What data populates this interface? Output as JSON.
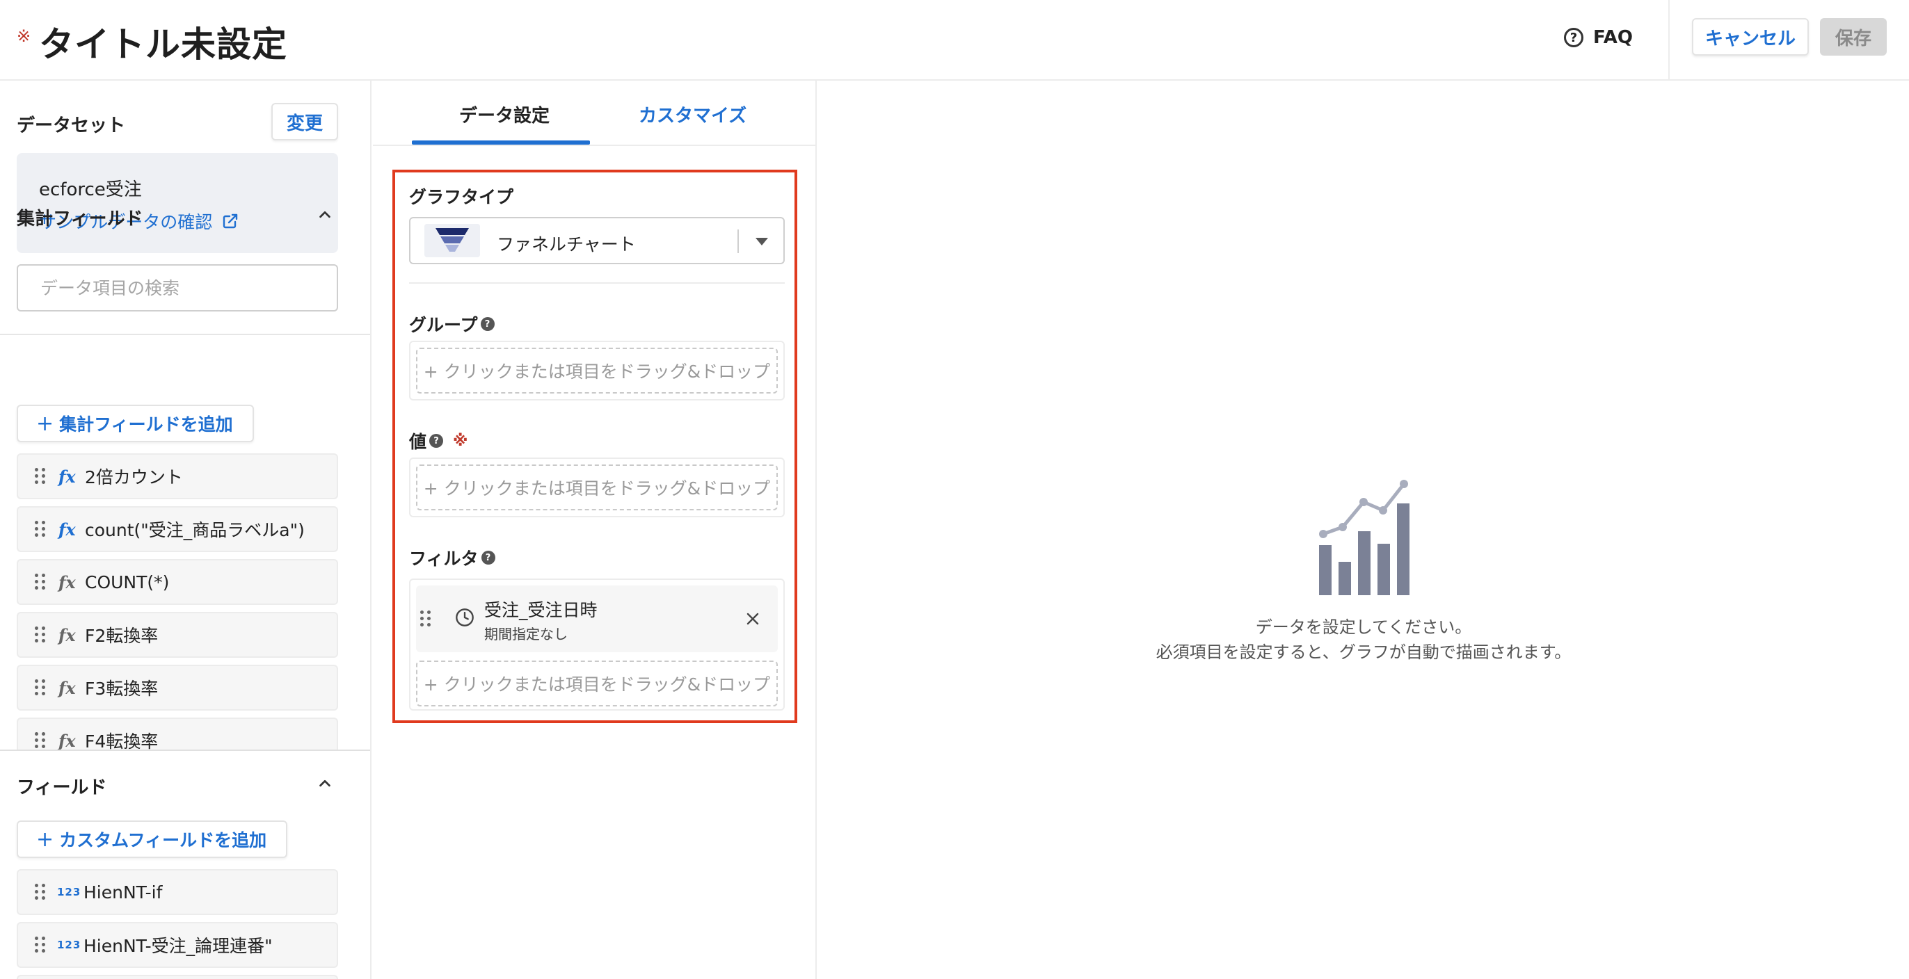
{
  "header": {
    "required_mark": "※",
    "title": "タイトル未設定",
    "faq_label": "FAQ",
    "cancel_label": "キャンセル",
    "save_label": "保存"
  },
  "left_panel": {
    "dataset_label": "データセット",
    "change_label": "変更",
    "dataset_name": "ecforce受注",
    "sample_link": "サンプルデータの確認",
    "search_placeholder": "データ項目の検索",
    "aggregate_section": {
      "title": "集計フィールド",
      "add_label": "集計フィールドを追加",
      "items": [
        {
          "label": "2倍カウント",
          "icon": "fx-blue-icon"
        },
        {
          "label": "count(\"受注_商品ラベルa\")",
          "icon": "fx-blue-icon"
        },
        {
          "label": "COUNT(*)",
          "icon": "fx-gray-icon"
        },
        {
          "label": "F2転換率",
          "icon": "fx-gray-icon"
        },
        {
          "label": "F3転換率",
          "icon": "fx-gray-icon"
        },
        {
          "label": "F4転換率",
          "icon": "fx-gray-icon"
        }
      ]
    },
    "field_section": {
      "title": "フィールド",
      "add_label": "カスタムフィールドを追加",
      "number_icon_text": "123",
      "items": [
        {
          "label": "HienNT-if"
        },
        {
          "label": "HienNT-受注_論理連番\""
        }
      ]
    }
  },
  "middle_panel": {
    "tabs": [
      {
        "label": "データ設定",
        "active": true
      },
      {
        "label": "カスタマイズ",
        "active": false
      }
    ],
    "graph_type": {
      "label": "グラフタイプ",
      "value": "ファネルチャート"
    },
    "group": {
      "label": "グループ",
      "placeholder": "+ クリックまたは項目をドラッグ&ドロップ"
    },
    "value": {
      "label": "値",
      "required_mark": "※",
      "placeholder": "+ クリックまたは項目をドラッグ&ドロップ"
    },
    "filter": {
      "label": "フィルタ",
      "item_name": "受注_受注日時",
      "item_sub": "期間指定なし",
      "placeholder": "+ クリックまたは項目をドラッグ&ドロップ"
    },
    "help_glyph": "?"
  },
  "right_panel": {
    "message_line1": "データを設定してください。",
    "message_line2": "必須項目を設定すると、グラフが自動で描画されます。"
  },
  "colors": {
    "accent": "#1f6fd1",
    "highlight": "#e03a1e",
    "required": "#c0392b",
    "placeholder_chart_bars": "#7b8196",
    "placeholder_chart_line": "#a8adbd"
  }
}
